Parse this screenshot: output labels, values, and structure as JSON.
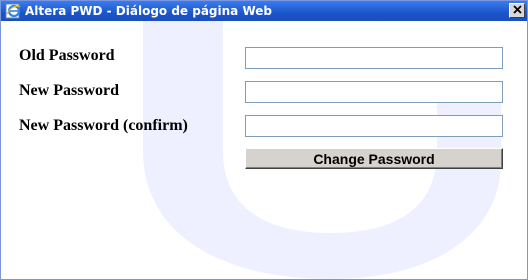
{
  "window": {
    "title": "Altera PWD - Diálogo de página Web",
    "close_label": "✕"
  },
  "form": {
    "old_password_label": "Old Password",
    "new_password_label": "New Password",
    "confirm_password_label": "New Password (confirm)",
    "old_password_value": "",
    "new_password_value": "",
    "confirm_password_value": "",
    "submit_label": "Change Password"
  },
  "colors": {
    "titlebar": "#1b55c9",
    "watermark": "#eef0ff",
    "button_face": "#d6d3ce"
  },
  "icons": {
    "title_icon": "ie-page-icon",
    "close_icon": "close-icon"
  }
}
